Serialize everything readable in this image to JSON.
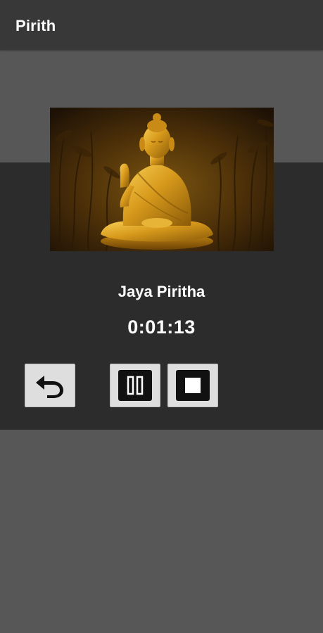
{
  "app_bar": {
    "title": "Pirith"
  },
  "player": {
    "cover_image": "golden-buddha-statue",
    "track_title": "Jaya Piritha",
    "elapsed_time": "0:01:13",
    "controls": {
      "back_icon": "undo-arrow-icon",
      "pause_icon": "pause-icon",
      "stop_icon": "stop-icon"
    }
  },
  "colors": {
    "app_bar_bg": "#383838",
    "page_bg": "#575757",
    "panel_bg": "#2c2c2c",
    "button_bg": "#dedede",
    "text": "#ffffff"
  }
}
